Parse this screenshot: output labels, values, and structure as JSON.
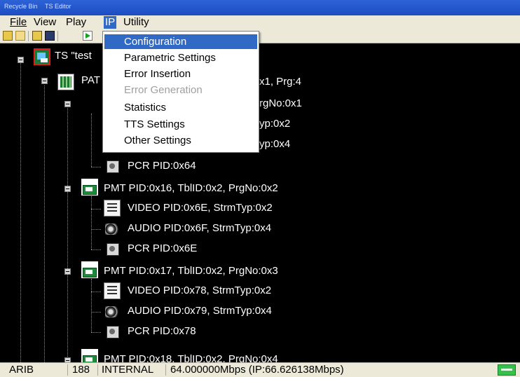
{
  "titlebar": {
    "left_text": "Recycle Bin",
    "right_text": "TS Editor"
  },
  "menubar": {
    "file": "File",
    "view": "View",
    "play": "Play",
    "ip": "IP",
    "utility": "Utility"
  },
  "ip_menu": {
    "items": [
      {
        "label": "Configuration",
        "state": "highlighted"
      },
      {
        "label": "Parametric Settings",
        "state": "enabled"
      },
      {
        "label": "Error Insertion",
        "state": "enabled"
      },
      {
        "label": "Error Generation",
        "state": "disabled"
      },
      {
        "label": "Statistics",
        "state": "enabled"
      },
      {
        "label": "TTS Settings",
        "state": "enabled"
      },
      {
        "label": "Other Settings",
        "state": "enabled"
      }
    ]
  },
  "toolbar": {
    "icons": [
      "open-folder-icon",
      "folder-icon",
      "open-file-icon",
      "save-icon",
      "play-icon"
    ]
  },
  "tree": {
    "ts": {
      "label": "TS \"test"
    },
    "pat": {
      "label_left": "PAT",
      "label_right": "x1, Prg:4"
    },
    "pmt1": {
      "label_right": "rgNo:0x1",
      "video_right": "yp:0x2",
      "audio_right": "yp:0x4",
      "pcr": "PCR PID:0x64"
    },
    "pmt2": {
      "label": "PMT PID:0x16, TblID:0x2, PrgNo:0x2",
      "video": "VIDEO PID:0x6E, StrmTyp:0x2",
      "audio": "AUDIO PID:0x6F, StrmTyp:0x4",
      "pcr": "PCR PID:0x6E"
    },
    "pmt3": {
      "label": "PMT PID:0x17, TblID:0x2, PrgNo:0x3",
      "video": "VIDEO PID:0x78, StrmTyp:0x2",
      "audio": "AUDIO PID:0x79, StrmTyp:0x4",
      "pcr": "PCR PID:0x78"
    },
    "pmt4": {
      "label_partial": "PMT PID:0x18, TblID:0x2, PrgNo:0x4"
    }
  },
  "statusbar": {
    "standard": "ARIB",
    "packet_size": "188",
    "clock_source": "INTERNAL",
    "rate": "64.000000Mbps (IP:66.626138Mbps)"
  },
  "colors": {
    "highlight": "#316ac5",
    "tree_bg": "#000000",
    "led": "#34c24a"
  }
}
